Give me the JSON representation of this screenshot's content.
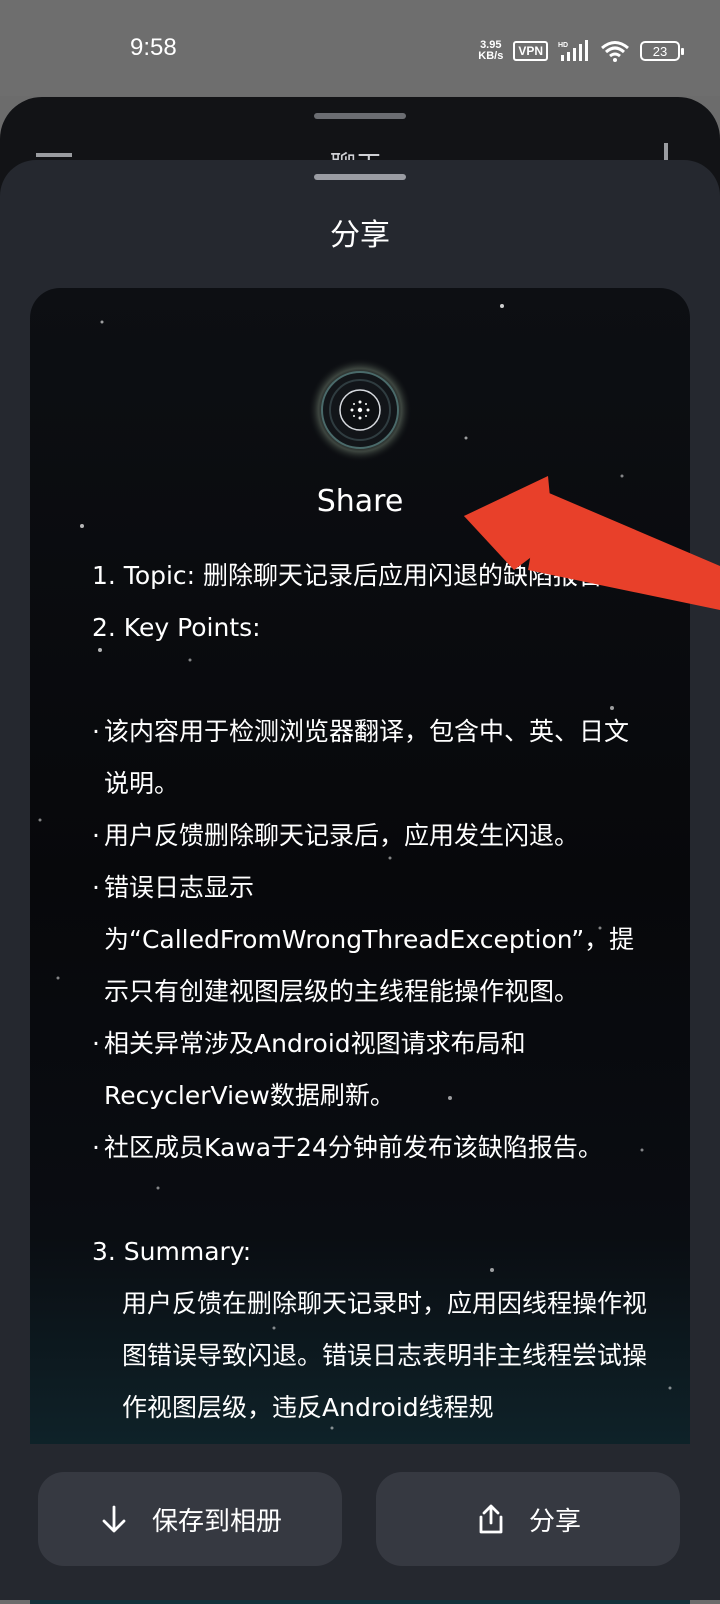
{
  "status_bar": {
    "time": "9:58",
    "net_speed_value": "3.95",
    "net_speed_unit": "KB/s",
    "vpn": "VPN",
    "battery": "23"
  },
  "background_sheet": {
    "title": "聊天"
  },
  "share_sheet": {
    "title": "分享",
    "card": {
      "heading": "Share",
      "lines": {
        "topic": "1. Topic: 删除聊天记录后应用闪退的缺陷报告",
        "key_points": "2. Key Points:",
        "kp1": "该内容用于检测浏览器翻译，包含中、英、日文说明。",
        "kp2": "用户反馈删除聊天记录后，应用发生闪退。",
        "kp3": "错误日志显示为“CalledFromWrongThreadException”，提示只有创建视图层级的主线程能操作视图。",
        "kp4": "相关异常涉及Android视图请求布局和RecyclerView数据刷新。",
        "kp5": "社区成员Kawa于24分钟前发布该缺陷报告。",
        "summary_title": "3. Summary:",
        "summary_text": "用户反馈在删除聊天记录时，应用因线程操作视图错误导致闪退。错误日志表明非主线程尝试操作视图层级，违反Android线程规"
      },
      "bullet_symbol": "·"
    },
    "actions": {
      "save_label": "保存到相册",
      "share_label": "分享"
    }
  },
  "colors": {
    "annotation_arrow": "#e8402a",
    "sheet_bg": "#25282f",
    "button_bg": "#363941"
  },
  "icons": {
    "save": "arrow-down-icon",
    "share": "share-upload-icon",
    "logo": "ai-orb-logo"
  }
}
